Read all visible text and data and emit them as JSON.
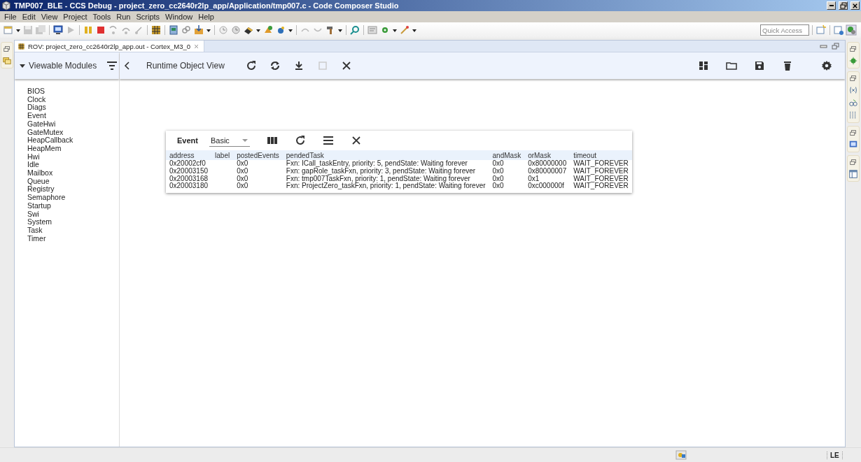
{
  "window": {
    "title": "TMP007_BLE - CCS Debug - project_zero_cc2640r2lp_app/Application/tmp007.c - Code Composer Studio"
  },
  "menu": [
    "File",
    "Edit",
    "View",
    "Project",
    "Tools",
    "Run",
    "Scripts",
    "Window",
    "Help"
  ],
  "quick_access": {
    "placeholder": "Quick Access"
  },
  "editor_tab": {
    "title": "ROV: project_zero_cc2640r2lp_app.out - Cortex_M3_0"
  },
  "rov": {
    "sidebar": {
      "heading": "Viewable Modules",
      "modules": [
        "BIOS",
        "Clock",
        "Diags",
        "Event",
        "GateHwi",
        "GateMutex",
        "HeapCallback",
        "HeapMem",
        "Hwi",
        "Idle",
        "Mailbox",
        "Queue",
        "Registry",
        "Semaphore",
        "Startup",
        "Swi",
        "System",
        "Task",
        "Timer"
      ]
    },
    "toolbar": {
      "title": "Runtime Object View"
    },
    "view": {
      "module": "Event",
      "view_select": {
        "value": "Basic"
      },
      "table": {
        "columns": [
          "address",
          "label",
          "postedEvents",
          "pendedTask",
          "andMask",
          "orMask",
          "timeout"
        ],
        "rows": [
          {
            "address": "0x20002cf0",
            "postedEvents": "0x0",
            "pendedTask": "Fxn: ICall_taskEntry, priority: 5, pendState: Waiting forever",
            "andMask": "0x0",
            "orMask": "0x80000000",
            "timeout": "WAIT_FOREVER"
          },
          {
            "address": "0x20003150",
            "postedEvents": "0x0",
            "pendedTask": "Fxn: gapRole_taskFxn, priority: 3, pendState: Waiting forever",
            "andMask": "0x0",
            "orMask": "0x80000007",
            "timeout": "WAIT_FOREVER"
          },
          {
            "address": "0x20003168",
            "postedEvents": "0x0",
            "pendedTask": "Fxn: tmp007TaskFxn, priority: 1, pendState: Waiting forever",
            "andMask": "0x0",
            "orMask": "0x1",
            "timeout": "WAIT_FOREVER"
          },
          {
            "address": "0x20003180",
            "postedEvents": "0x0",
            "pendedTask": "Fxn: ProjectZero_taskFxn, priority: 1, pendState: Waiting forever",
            "andMask": "0x0",
            "orMask": "0xc000000f",
            "timeout": "WAIT_FOREVER"
          }
        ]
      }
    }
  },
  "status_bar": {
    "byte_order": "LE"
  }
}
